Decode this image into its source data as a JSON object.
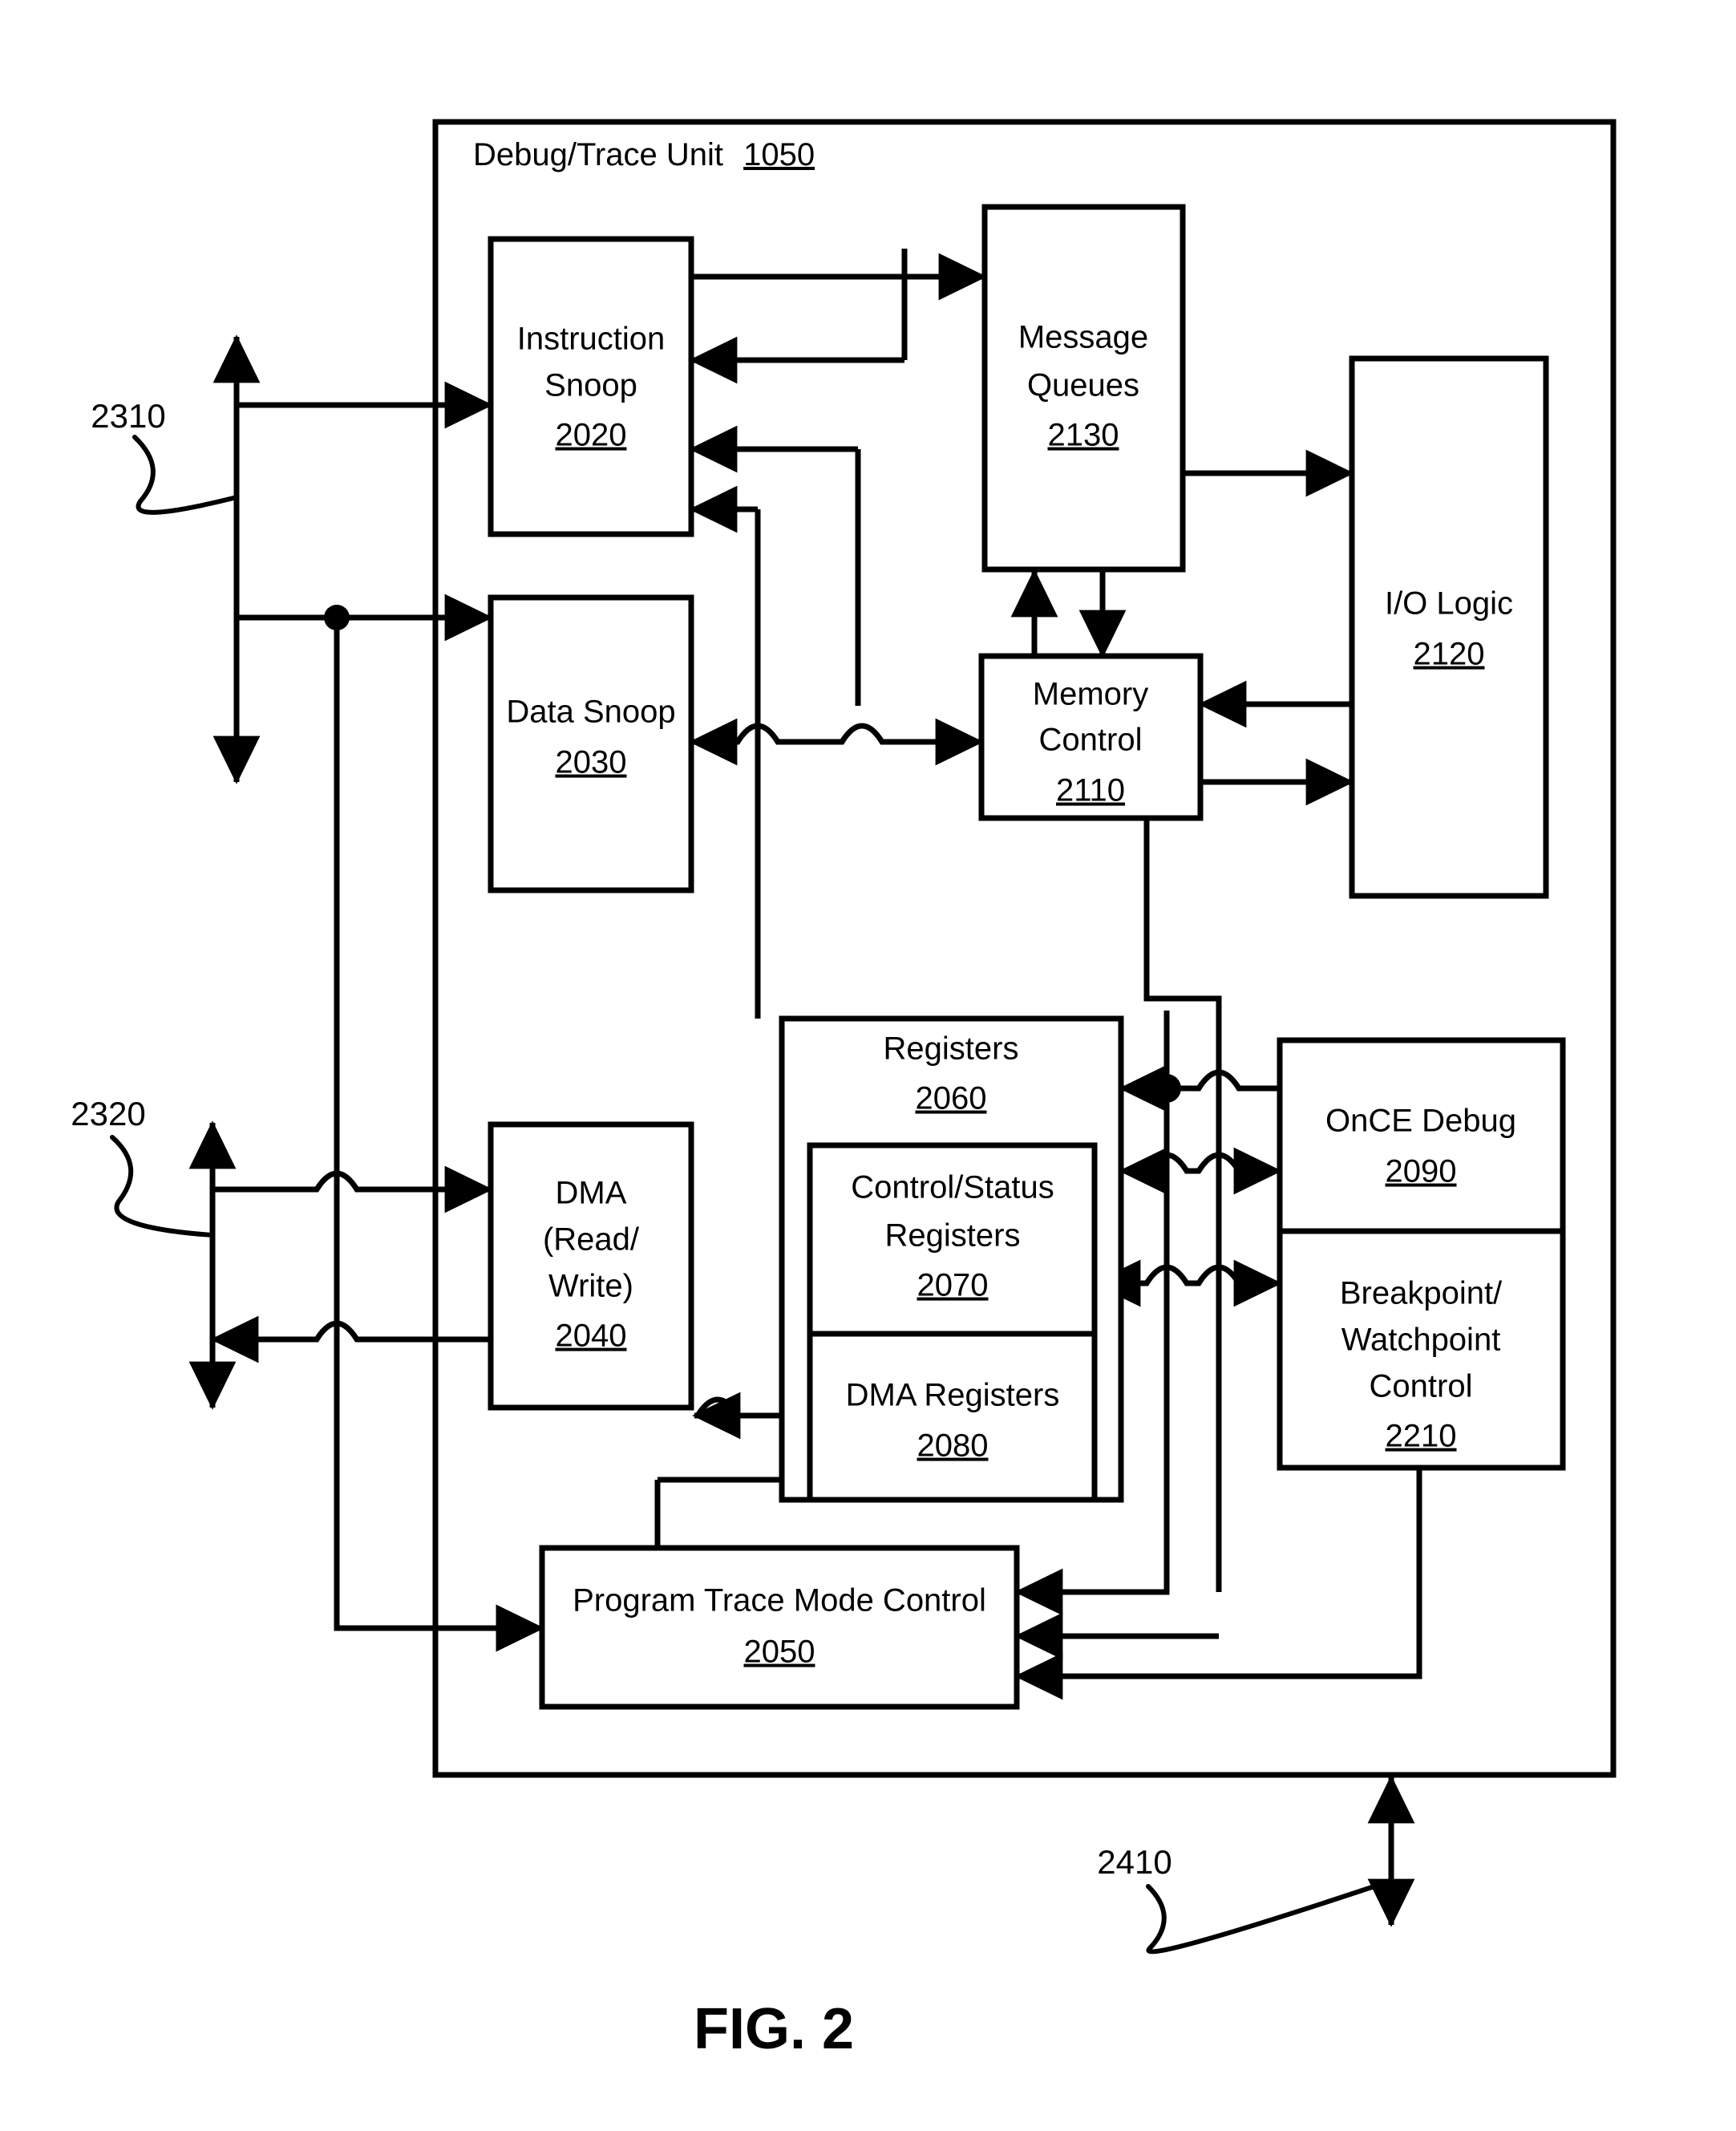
{
  "figure": {
    "caption": "FIG. 2",
    "container": {
      "title": "Debug/Trace Unit",
      "number": "1050"
    }
  },
  "blocks": [
    {
      "id": "instruction_snoop",
      "lines": [
        "Instruction",
        "Snoop"
      ],
      "number": "2020"
    },
    {
      "id": "message_queues",
      "lines": [
        "Message",
        "Queues"
      ],
      "number": "2130"
    },
    {
      "id": "io_logic",
      "lines": [
        "I/O Logic"
      ],
      "number": "2120"
    },
    {
      "id": "data_snoop",
      "lines": [
        "Data Snoop"
      ],
      "number": "2030"
    },
    {
      "id": "memory_control",
      "lines": [
        "Memory",
        "Control"
      ],
      "number": "2110"
    },
    {
      "id": "registers",
      "lines": [
        "Registers"
      ],
      "number": "2060"
    },
    {
      "id": "control_status_registers",
      "lines": [
        "Control/Status",
        "Registers"
      ],
      "number": "2070"
    },
    {
      "id": "dma_registers",
      "lines": [
        "DMA Registers"
      ],
      "number": "2080"
    },
    {
      "id": "once_debug",
      "lines": [
        "OnCE Debug"
      ],
      "number": "2090"
    },
    {
      "id": "breakpoint_watchpoint_control",
      "lines": [
        "Breakpoint/",
        "Watchpoint",
        "Control"
      ],
      "number": "2210"
    },
    {
      "id": "dma",
      "lines": [
        "DMA",
        "(Read/",
        "Write)"
      ],
      "number": "2040"
    },
    {
      "id": "program_trace_mode_control",
      "lines": [
        "Program Trace Mode Control"
      ],
      "number": "2050"
    }
  ],
  "reference_numerals": [
    {
      "id": "bus_2310",
      "label": "2310"
    },
    {
      "id": "bus_2320",
      "label": "2320"
    },
    {
      "id": "bus_2410",
      "label": "2410"
    }
  ],
  "colors": {
    "stroke": "#000000",
    "background": "#ffffff"
  }
}
